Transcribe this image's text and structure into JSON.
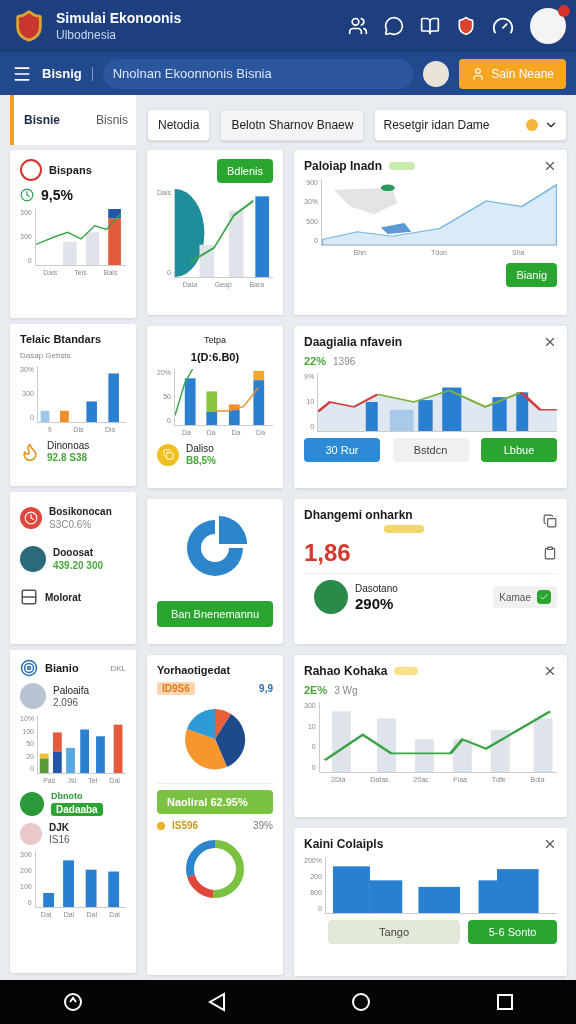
{
  "header": {
    "title": "Simulai Ekonoonis",
    "subtitle": "Ulbodnesia"
  },
  "navbar": {
    "section": "Bisnig",
    "search": "Nnolnan Ekoonnonis Bisnia",
    "action": "Sain Neane"
  },
  "side_tabs": [
    {
      "label": "Bisnie",
      "selected": true
    },
    {
      "label": "Bisnis",
      "selected": false
    }
  ],
  "toolbar": {
    "buttons": [
      "Netodia",
      "Belotn Sharnov Bnaew"
    ],
    "dropdown": "Resetgir idan Dame"
  },
  "left": {
    "card_1": {
      "title": "Bispans",
      "value": "9,5%",
      "chart": {
        "kind": "bar-line",
        "y_labels": [
          "300",
          "300",
          "0"
        ],
        "x_labels": [
          "Dais",
          "Tels",
          "Bais"
        ]
      }
    },
    "card_2": {
      "title": "Telaic Btandars",
      "subtitle": "Dasap Gebsts",
      "chart": {
        "kind": "bars",
        "y_labels": [
          "30%",
          "300",
          "0"
        ],
        "x_labels": [
          "9",
          "Dis",
          "Dis"
        ]
      },
      "footer_label": "Dinonoas",
      "footer_value": "92.8 S38"
    },
    "list": [
      {
        "kind": "clock",
        "label": "Bosikonocan",
        "value": "S3C0.6%"
      },
      {
        "kind": "avatar",
        "label": "Dooosat",
        "value": "439.20 300"
      },
      {
        "kind": "layout",
        "label": "Molorat"
      }
    ],
    "card_4": {
      "title": "Bianio",
      "note": "DKL",
      "person": "Paloaifa",
      "person_value": "2.096",
      "chart": {
        "kind": "stacked",
        "y_labels": [
          "10%",
          "100",
          "50",
          "20",
          "0"
        ],
        "x_labels": [
          "Pas",
          "Jsi",
          "Tel",
          "Dal"
        ]
      },
      "status_label": "Dbnoto",
      "status_badge": "Dadaaba",
      "item_label": "DJK",
      "item_value": "IS16",
      "chart_2": {
        "kind": "plain-bars",
        "y_labels": [
          "300",
          "200",
          "100",
          "0"
        ],
        "x_labels": [
          "Dai",
          "Dai",
          "Dai",
          "Dai"
        ]
      }
    }
  },
  "middle": {
    "card_1": {
      "button": "Bdlenis",
      "chart": {
        "kind": "globe-bars",
        "y_labels": [
          "Dais",
          "0"
        ],
        "x_labels": [
          "Daia",
          "Geap",
          "Bara"
        ]
      }
    },
    "card_2": {
      "title": "Tetpa",
      "value": "1(D:6.B0)",
      "chart": {
        "kind": "combo",
        "y_labels": [
          "20%",
          "50",
          "0"
        ],
        "x_labels": [
          "Da",
          "Da",
          "Da",
          "Da"
        ]
      },
      "footer_label": "Daliso",
      "footer_value": "B8,5%"
    },
    "card_3": {
      "button": "Ban Bnenemannu"
    },
    "card_4": {
      "title": "Yorhaotigedat",
      "tag": "ID9S6",
      "tag_value": "9,9",
      "bar": "Naoliral 62.95%",
      "legend": "IS596",
      "legend_value": "39%"
    }
  },
  "right": {
    "card_1": {
      "title": "Paloiap Inadn",
      "chart": {
        "kind": "area-map",
        "y_labels": [
          "900",
          "30%",
          "500",
          "0"
        ],
        "x_labels": [
          "Bhn",
          "Tdon",
          "Sha"
        ]
      },
      "button": "Bianig"
    },
    "card_2": {
      "title": "Daagialia nfavein",
      "value": "22%",
      "note": "1396",
      "chart": {
        "kind": "wave-bars",
        "y_labels": [
          "9%",
          "10",
          "0"
        ]
      },
      "buttons": [
        {
          "kind": "primary",
          "label": "30 Rur"
        },
        {
          "kind": "muted",
          "label": "Bstdcn"
        },
        {
          "kind": "success",
          "label": "Lbbue"
        }
      ]
    },
    "card_3": {
      "title": "Dhangemi onharkn",
      "value": "1,86",
      "person": "Dasotano",
      "person_value": "290%",
      "chip": "Kamae"
    },
    "card_4": {
      "title": "Rahao Kohaka",
      "value": "2E%",
      "note": "3 Wg",
      "chart": {
        "kind": "light-bar-line",
        "y_labels": [
          "300",
          "10",
          "0",
          "0"
        ],
        "x_labels": [
          "2Dia",
          "Dafas",
          "20ac",
          "Fiaa",
          "Tdfe",
          "Boia"
        ]
      }
    },
    "card_5": {
      "title": "Kaini Colaipls",
      "chart": {
        "kind": "blocks",
        "y_labels": [
          "200%",
          "200",
          "800",
          "0"
        ]
      },
      "buttons": [
        {
          "kind": "pale",
          "label": "Tango"
        },
        {
          "kind": "success",
          "label": "5-6 Sonto"
        }
      ]
    }
  }
}
